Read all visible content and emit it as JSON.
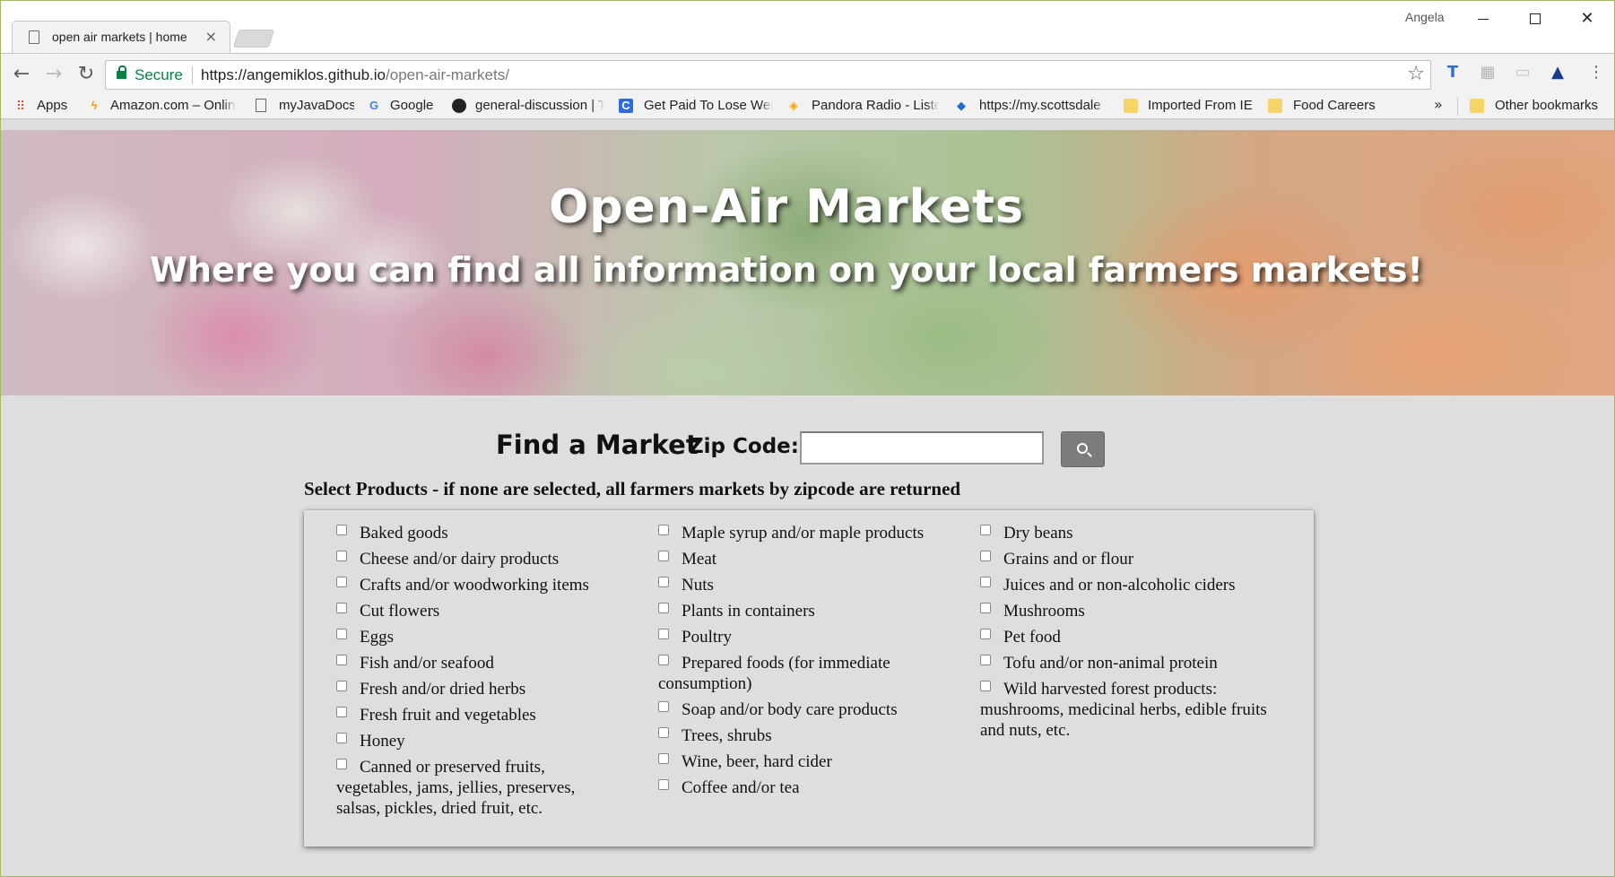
{
  "browser": {
    "tab_title": "open air markets | home",
    "tab_close": "×",
    "user": "Angela",
    "secure_label": "Secure",
    "url_scheme_host": "https://angemiklos.github.io",
    "url_path": "/open-air-markets/",
    "bookmarks": [
      {
        "label": "Apps",
        "icon": "apps-grid-icon"
      },
      {
        "label": "Amazon.com – Online",
        "icon": "amazon-icon"
      },
      {
        "label": "myJavaDocs",
        "icon": "page-icon"
      },
      {
        "label": "Google",
        "icon": "google-icon"
      },
      {
        "label": "general-discussion | T",
        "icon": "github-icon"
      },
      {
        "label": "Get Paid To Lose Weig",
        "icon": "c-icon"
      },
      {
        "label": "Pandora Radio - Liste",
        "icon": "pandora-icon"
      },
      {
        "label": "https://my.scottsdale",
        "icon": "diamond-icon"
      },
      {
        "label": "Imported From IE",
        "icon": "folder-icon"
      },
      {
        "label": "Food Careers",
        "icon": "folder-icon"
      }
    ],
    "bookmarks_more": "»",
    "other_bookmarks": "Other bookmarks"
  },
  "hero": {
    "title": "Open-Air Markets",
    "subtitle": "Where you can find all information on your local farmers markets!"
  },
  "search": {
    "heading": "Find a Market",
    "zip_label": "Zip Code:",
    "zip_value": ""
  },
  "products": {
    "instruction": "Select Products - if none are selected, all farmers markets by zipcode are returned",
    "columns": [
      [
        "Baked goods",
        "Cheese and/or dairy products",
        "Crafts and/or woodworking items",
        "Cut flowers",
        "Eggs",
        "Fish and/or seafood",
        "Fresh and/or dried herbs",
        "Fresh fruit and vegetables",
        "Honey",
        "Canned or preserved fruits, vegetables, jams, jellies, preserves, salsas, pickles, dried fruit, etc."
      ],
      [
        "Maple syrup and/or maple products",
        "Meat",
        "Nuts",
        "Plants in containers",
        "Poultry",
        "Prepared foods (for immediate consumption)",
        "Soap and/or body care products",
        "Trees, shrubs",
        "Wine, beer, hard cider",
        "Coffee and/or tea"
      ],
      [
        "Dry beans",
        "Grains and or flour",
        "Juices and or non-alcoholic ciders",
        "Mushrooms",
        "Pet food",
        "Tofu and/or non-animal protein",
        "Wild harvested forest products: mushrooms, medicinal herbs, edible fruits and nuts, etc."
      ]
    ]
  }
}
